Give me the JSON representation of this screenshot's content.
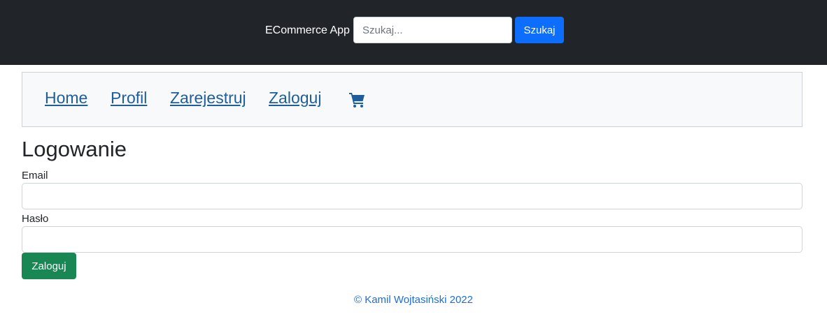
{
  "header": {
    "brand": "ECommerce App",
    "search_placeholder": "Szukaj...",
    "search_value": "",
    "search_button": "Szukaj"
  },
  "nav": {
    "items": [
      {
        "label": "Home"
      },
      {
        "label": "Profil"
      },
      {
        "label": "Zarejestruj"
      },
      {
        "label": "Zaloguj"
      }
    ],
    "cart_icon": "cart-icon"
  },
  "main": {
    "title": "Logowanie",
    "email_label": "Email",
    "email_value": "",
    "password_label": "Hasło",
    "password_value": "",
    "submit_label": "Zaloguj"
  },
  "footer": {
    "text": "© Kamil Wojtasiński 2022"
  },
  "colors": {
    "topbar": "#212529",
    "primary": "#0d6efd",
    "success": "#198754",
    "link": "#1f5e9a"
  }
}
